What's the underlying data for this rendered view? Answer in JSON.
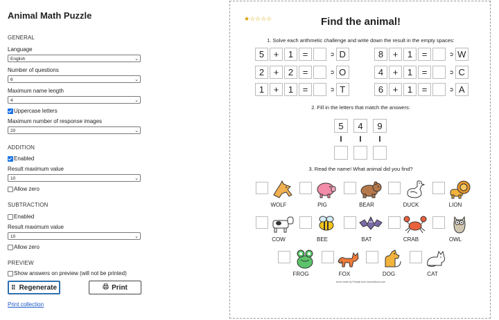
{
  "app": {
    "title": "Animal Math Puzzle"
  },
  "settings": {
    "general_heading": "GENERAL",
    "language_label": "Language",
    "language_value": "English",
    "num_questions_label": "Number of questions",
    "num_questions_value": "6",
    "max_name_label": "Maximum name length",
    "max_name_value": "4",
    "uppercase_label": "Uppercase letters",
    "max_images_label": "Maximum number of response images",
    "max_images_value": "20",
    "addition_heading": "ADDITION",
    "add_enabled_label": "Enabled",
    "add_result_label": "Result maximum value",
    "add_result_value": "10",
    "add_zero_label": "Allow zero",
    "subtraction_heading": "SUBTRACTION",
    "sub_enabled_label": "Enabled",
    "sub_result_label": "Result maximum value",
    "sub_result_value": "10",
    "sub_zero_label": "Allow zero",
    "preview_heading": "PREVIEW",
    "show_answers_label": "Show answers on preview (will not be printed)",
    "regenerate_label": "Regenerate",
    "print_label": "Print",
    "print_collection_label": "Print collection"
  },
  "preview": {
    "stars": "★☆☆☆☆",
    "title": "Find the animal!",
    "step1": "1. Solve each arithmetic challenge and write down the result in the empty spaces:",
    "step2": "2. Fill in the letters that match the answers:",
    "step3": "3. Read the name! What animal did you find?",
    "equations": [
      {
        "a": "5",
        "op": "+",
        "b": "1",
        "eq": "=",
        "letter": "D"
      },
      {
        "a": "8",
        "op": "+",
        "b": "1",
        "eq": "=",
        "letter": "W"
      },
      {
        "a": "2",
        "op": "+",
        "b": "2",
        "eq": "=",
        "letter": "O"
      },
      {
        "a": "4",
        "op": "+",
        "b": "1",
        "eq": "=",
        "letter": "C"
      },
      {
        "a": "1",
        "op": "+",
        "b": "1",
        "eq": "=",
        "letter": "T"
      },
      {
        "a": "6",
        "op": "+",
        "b": "1",
        "eq": "=",
        "letter": "A"
      }
    ],
    "answers": [
      "5",
      "4",
      "9"
    ],
    "animals": [
      "WOLF",
      "PIG",
      "BEAR",
      "DUCK",
      "LION",
      "COW",
      "BEE",
      "BAT",
      "CRAB",
      "OWL",
      "FROG",
      "FOX",
      "DOG",
      "CAT"
    ],
    "credit": "Icons made by Freepik from www.flaticon.com"
  }
}
